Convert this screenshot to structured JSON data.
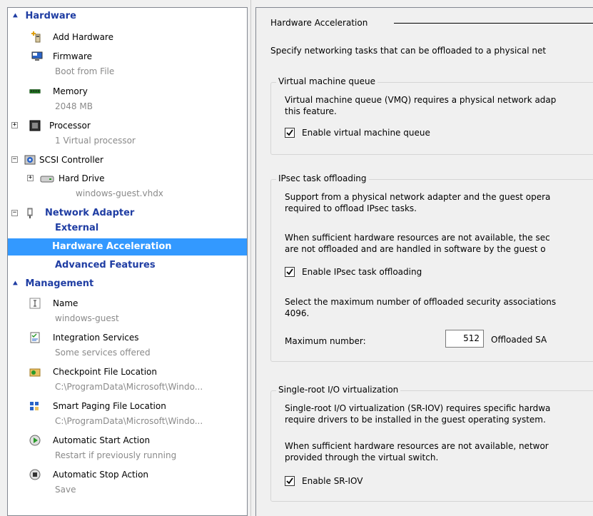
{
  "tree": {
    "hardware_header": "Hardware",
    "add_hardware": "Add Hardware",
    "firmware": {
      "label": "Firmware",
      "sub": "Boot from File"
    },
    "memory": {
      "label": "Memory",
      "sub": "2048 MB"
    },
    "processor": {
      "label": "Processor",
      "sub": "1 Virtual processor"
    },
    "scsi": "SCSI Controller",
    "hard_drive": {
      "label": "Hard Drive",
      "sub": "windows-guest.vhdx"
    },
    "network_adapter": "Network Adapter",
    "external": "External",
    "hw_accel": "Hardware Acceleration",
    "advanced": "Advanced Features",
    "management_header": "Management",
    "name": {
      "label": "Name",
      "sub": "windows-guest"
    },
    "integration": {
      "label": "Integration Services",
      "sub": "Some services offered"
    },
    "checkpoint": {
      "label": "Checkpoint File Location",
      "sub": "C:\\ProgramData\\Microsoft\\Windo..."
    },
    "smart_paging": {
      "label": "Smart Paging File Location",
      "sub": "C:\\ProgramData\\Microsoft\\Windo..."
    },
    "auto_start": {
      "label": "Automatic Start Action",
      "sub": "Restart if previously running"
    },
    "auto_stop": {
      "label": "Automatic Stop Action",
      "sub": "Save"
    }
  },
  "details": {
    "title": "Hardware Acceleration",
    "intro": "Specify networking tasks that can be offloaded to a physical net",
    "vmq": {
      "title": "Virtual machine queue",
      "desc1": "Virtual machine queue (VMQ) requires a physical network adap",
      "desc2": "this feature.",
      "checkbox": "Enable virtual machine queue",
      "checked": true
    },
    "ipsec": {
      "title": "IPsec task offloading",
      "desc1": "Support from a physical network adapter and the guest opera",
      "desc2": "required to offload IPsec tasks.",
      "desc3": "When sufficient hardware resources are not available, the sec",
      "desc4": "are not offloaded and are handled in software by the guest o",
      "checkbox": "Enable IPsec task offloading",
      "checked": true,
      "select1": "Select the maximum number of offloaded security associations",
      "select2": "4096.",
      "max_label": "Maximum number:",
      "max_value": "512",
      "max_unit": "Offloaded SA"
    },
    "sriov": {
      "title": "Single-root I/O virtualization",
      "desc1": "Single-root I/O virtualization (SR-IOV) requires specific hardwa",
      "desc2": "require drivers to be installed in the guest operating system.",
      "desc3": "When sufficient hardware resources are not available, networ",
      "desc4": "provided through the virtual switch.",
      "checkbox": "Enable SR-IOV",
      "checked": true
    }
  }
}
